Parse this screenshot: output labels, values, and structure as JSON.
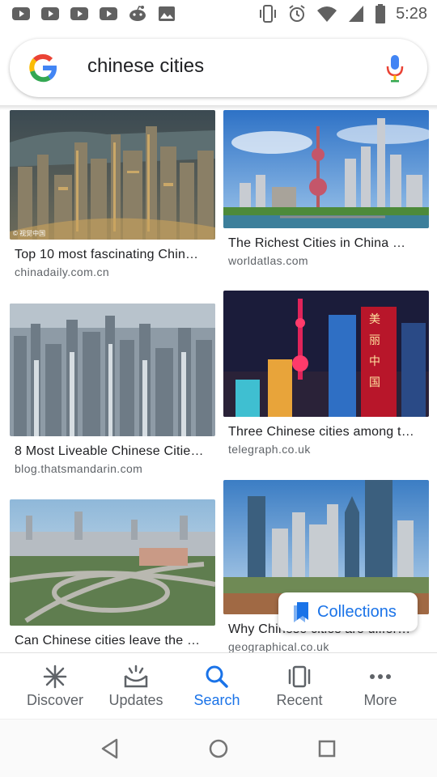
{
  "status_bar": {
    "time": "5:28",
    "notification_icons": [
      "youtube-icon",
      "youtube-icon",
      "youtube-icon",
      "youtube-icon",
      "reddit-icon",
      "gallery-icon"
    ],
    "system_icons": [
      "vibrate-icon",
      "alarm-icon",
      "wifi-icon",
      "signal-icon",
      "battery-icon"
    ]
  },
  "search": {
    "query": "chinese cities"
  },
  "results": [
    {
      "title": "Top 10 most fascinating Chin…",
      "source": "chinadaily.com.cn",
      "watermark": "© 视觉中国"
    },
    {
      "title": "The Richest Cities in China …",
      "source": "worldatlas.com"
    },
    {
      "title": "8 Most Liveable Chinese Citie…",
      "source": "blog.thatsmandarin.com"
    },
    {
      "title": "Three Chinese cities among t…",
      "source": "telegraph.co.uk"
    },
    {
      "title": "Can Chinese cities leave the …",
      "source": ""
    },
    {
      "title": "Why Chinese cities are differ…",
      "source": "geographical.co.uk"
    }
  ],
  "collections": {
    "label": "Collections"
  },
  "bottom_nav": {
    "items": [
      {
        "label": "Discover",
        "icon": "asterisk-icon"
      },
      {
        "label": "Updates",
        "icon": "updates-icon"
      },
      {
        "label": "Search",
        "icon": "search-icon",
        "active": true
      },
      {
        "label": "Recent",
        "icon": "recent-icon"
      },
      {
        "label": "More",
        "icon": "more-icon"
      }
    ]
  },
  "colors": {
    "accent": "#1a73e8",
    "inactive": "#5f6368"
  }
}
